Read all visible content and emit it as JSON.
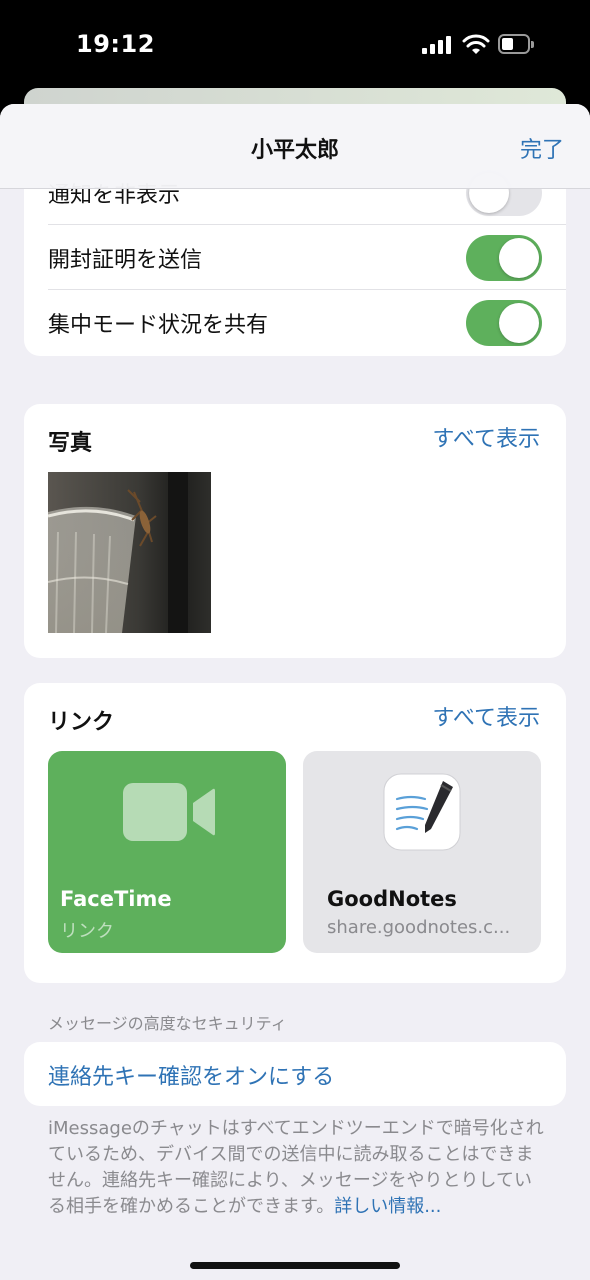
{
  "status_bar": {
    "time": "19:12"
  },
  "nav": {
    "title": "小平太郎",
    "done": "完了"
  },
  "settings": {
    "hide_alerts": "通知を非表示",
    "send_read_receipts": "開封証明を送信",
    "share_focus_status": "集中モード状況を共有",
    "toggles": {
      "hide_alerts": false,
      "send_read_receipts": true,
      "share_focus_status": true
    }
  },
  "photos": {
    "title": "写真",
    "see_all": "すべて表示"
  },
  "links": {
    "title": "リンク",
    "see_all": "すべて表示",
    "items": [
      {
        "title": "FaceTime",
        "subtitle": "リンク"
      },
      {
        "title": "GoodNotes",
        "subtitle": "share.goodnotes.c..."
      }
    ]
  },
  "security": {
    "caption": "メッセージの高度なセキュリティ",
    "action": "連絡先キー確認をオンにする",
    "footnote": "iMessageのチャットはすべてエンドツーエンドで暗号化されているため、デバイス間での送信中に読み取ることはできません。連絡先キー確認により、メッセージをやりとりしている相手を確かめることができます。",
    "more": "詳しい情報..."
  },
  "colors": {
    "accent": "#2f73b5",
    "toggle_on": "#5eb05c",
    "facetime": "#5eb05c"
  }
}
